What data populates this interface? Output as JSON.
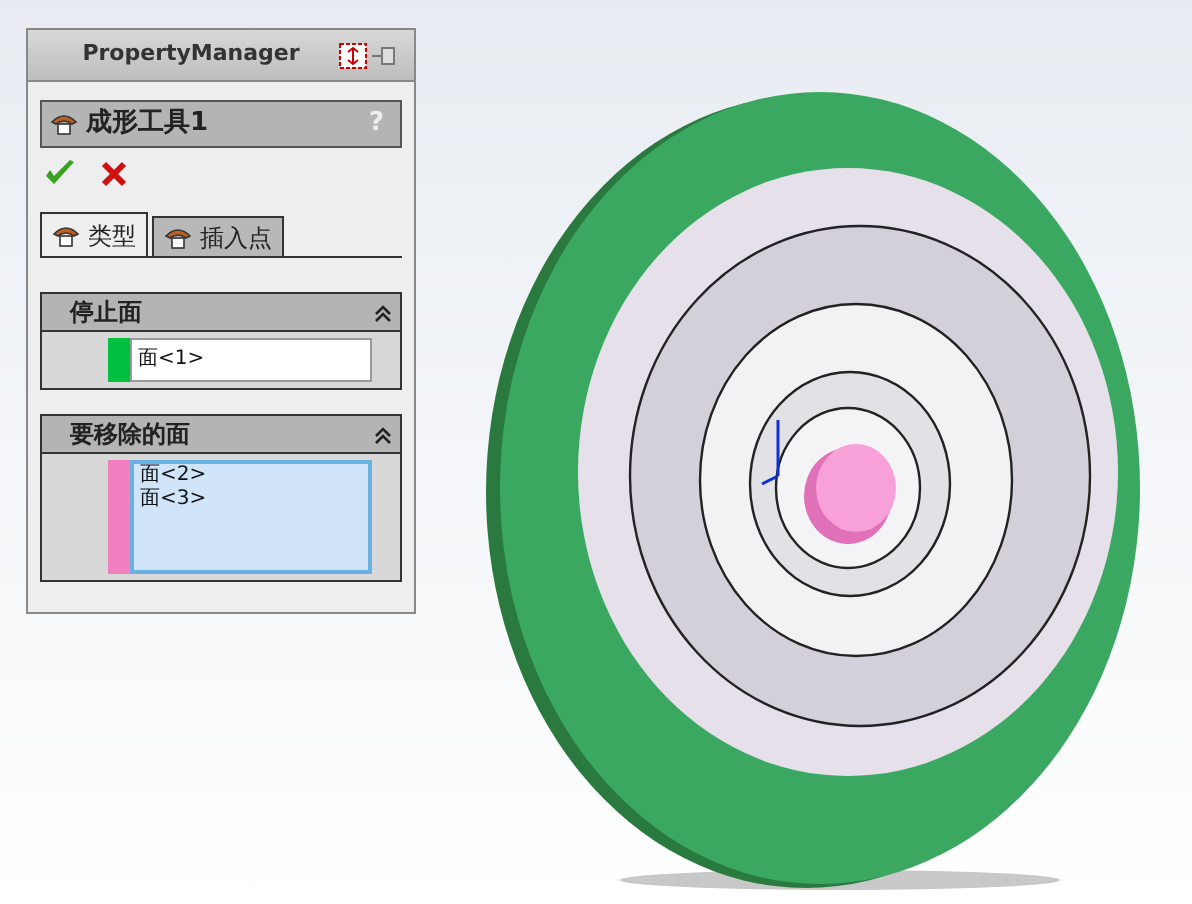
{
  "panel": {
    "title": "PropertyManager"
  },
  "feature": {
    "title": "成形工具1",
    "help": "?"
  },
  "tabs": [
    {
      "label": "类型",
      "selected": true
    },
    {
      "label": "插入点",
      "selected": false
    }
  ],
  "groups": [
    {
      "title": "停止面",
      "color": "#00c040",
      "active": false,
      "items": [
        "面<1>"
      ]
    },
    {
      "title": "要移除的面",
      "color": "#f080c0",
      "active": true,
      "items": [
        "面<2>",
        "面<3>"
      ]
    }
  ]
}
